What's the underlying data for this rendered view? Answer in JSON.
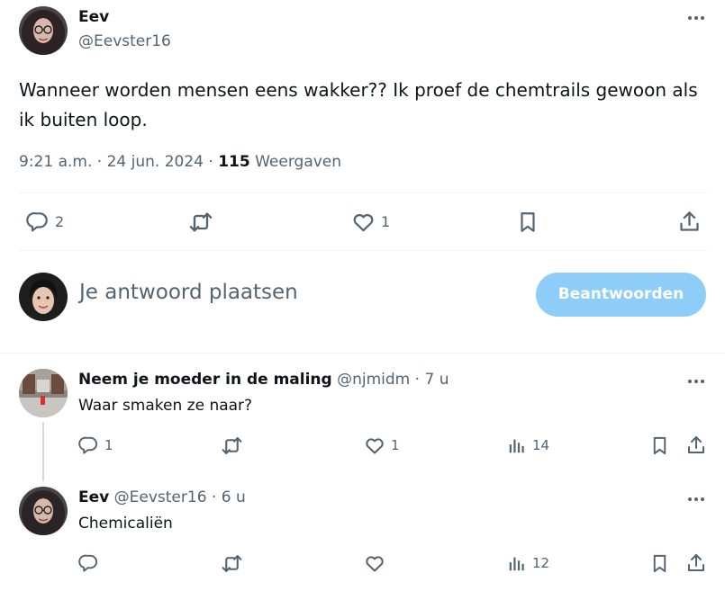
{
  "main_post": {
    "author_name": "Eev",
    "author_handle": "@Eevster16",
    "text": "Wanneer worden mensen eens wakker?? Ik proef de chemtrails gewoon als ik buiten loop.",
    "time": "9:21 a.m.",
    "separator": "·",
    "date": "24 jun. 2024",
    "views_count": "115",
    "views_label": "Weergaven",
    "replies": "2",
    "likes": "1"
  },
  "compose": {
    "placeholder": "Je antwoord plaatsen",
    "reply_button": "Beantwoorden"
  },
  "replies": [
    {
      "author_name": "Neem je moeder in de maling",
      "author_handle": "@njmidm",
      "separator": "·",
      "age": "7 u",
      "text": "Waar smaken ze naar?",
      "replies": "1",
      "likes": "1",
      "views": "14"
    },
    {
      "author_name": "Eev",
      "author_handle": "@Eevster16",
      "separator": "·",
      "age": "6 u",
      "text": "Chemicaliën",
      "replies": "",
      "likes": "",
      "views": "12"
    }
  ],
  "colors": {
    "accent": "#1d9bf0",
    "button_disabled": "#8ecdf8",
    "muted": "#536471",
    "divider": "#eff3f4",
    "thread_line": "#cfd9de"
  },
  "icons": [
    "more-icon",
    "reply-icon",
    "retweet-icon",
    "like-icon",
    "bookmark-icon",
    "share-icon",
    "views-icon"
  ]
}
